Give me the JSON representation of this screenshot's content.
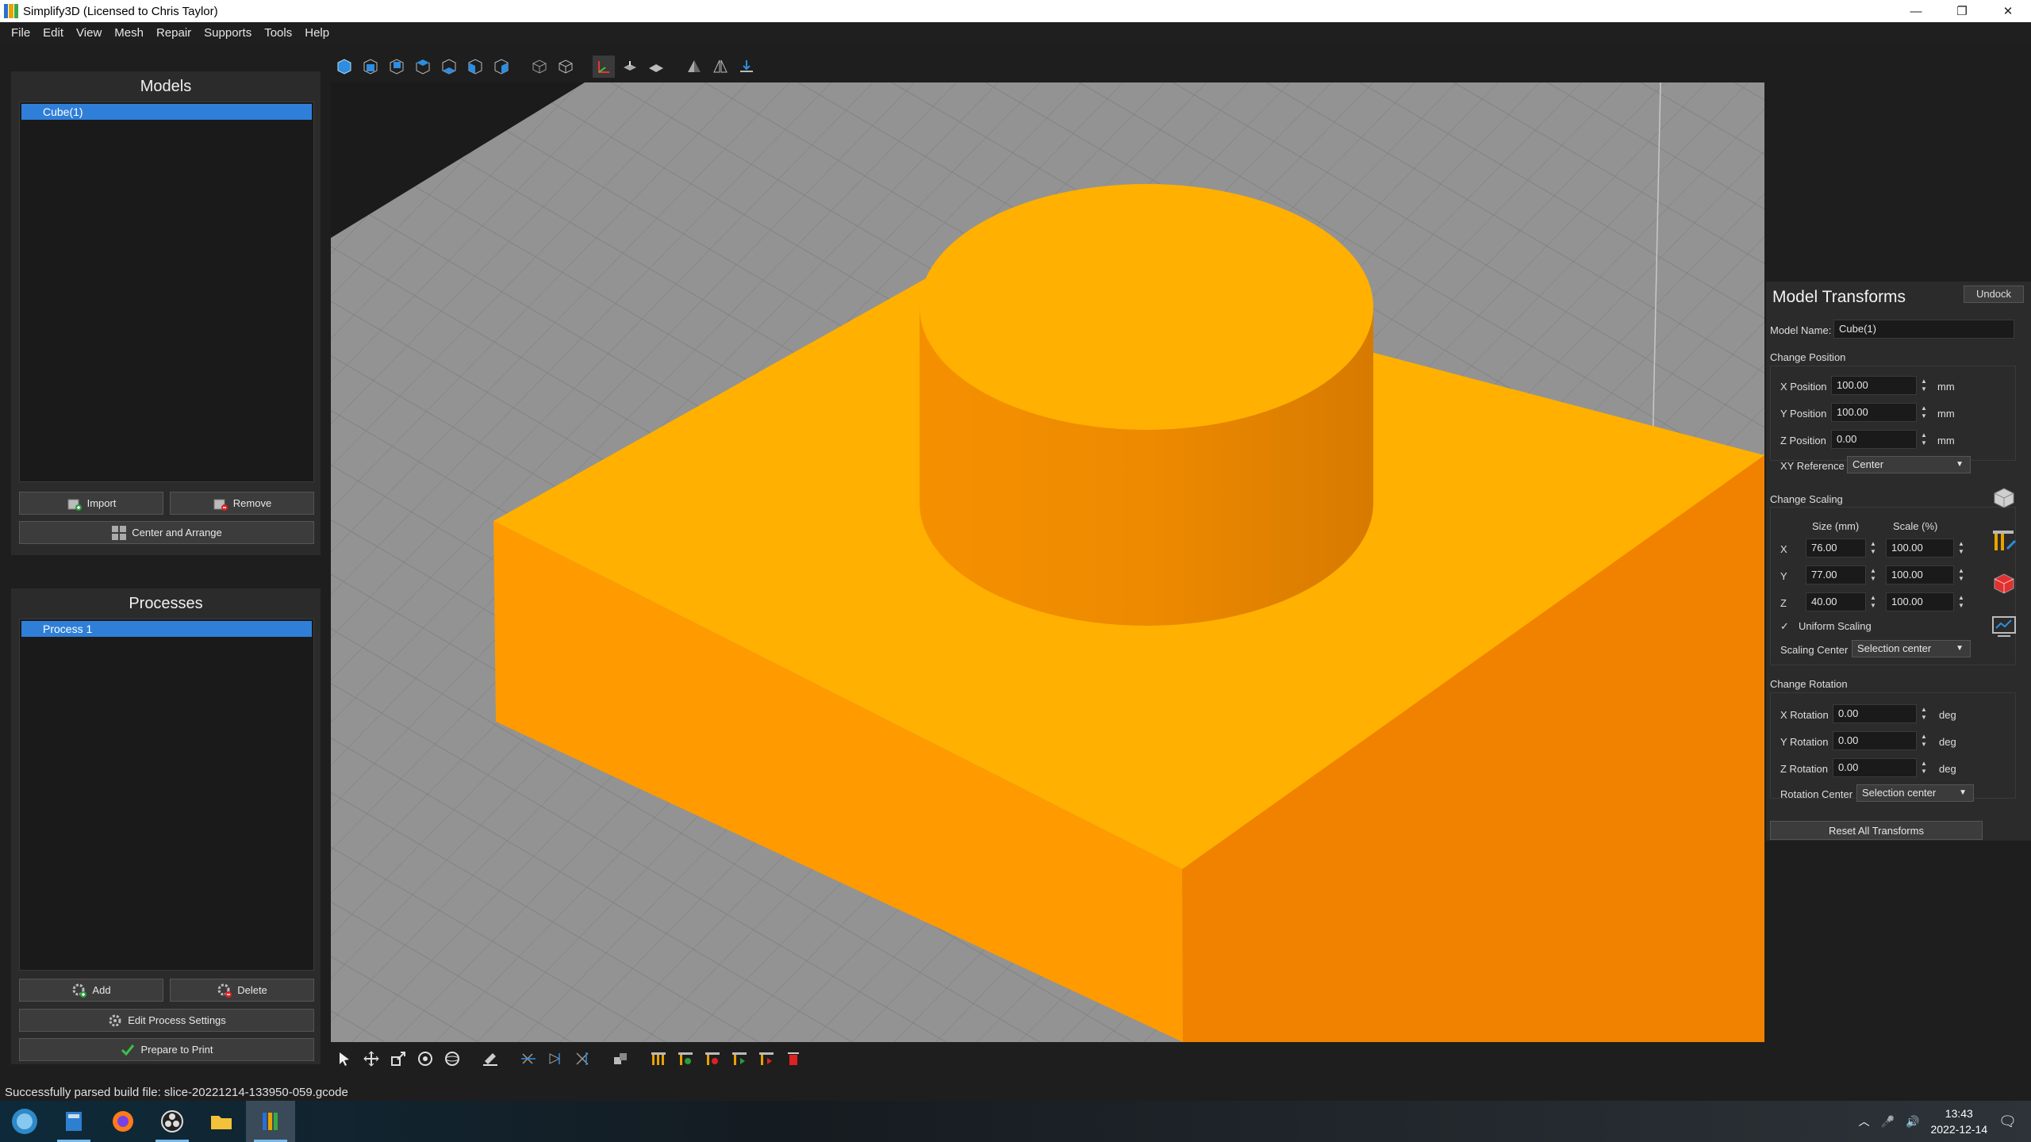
{
  "window": {
    "title": "Simplify3D (Licensed to Chris Taylor)",
    "controls": {
      "minimize": "—",
      "maximize": "❐",
      "close": "✕"
    }
  },
  "menu": [
    "File",
    "Edit",
    "View",
    "Mesh",
    "Repair",
    "Supports",
    "Tools",
    "Help"
  ],
  "models": {
    "title": "Models",
    "items": [
      "Cube(1)"
    ],
    "import": "Import",
    "remove": "Remove",
    "center_arrange": "Center and Arrange"
  },
  "processes": {
    "title": "Processes",
    "items": [
      "Process 1"
    ],
    "add": "Add",
    "delete": "Delete",
    "edit_settings": "Edit Process Settings",
    "prepare": "Prepare to Print"
  },
  "transforms": {
    "title": "Model Transforms",
    "undock": "Undock",
    "model_name_label": "Model Name:",
    "model_name": "Cube(1)",
    "change_position": "Change Position",
    "x_pos_label": "X Position",
    "x_pos": "100.00",
    "y_pos_label": "Y Position",
    "y_pos": "100.00",
    "z_pos_label": "Z Position",
    "z_pos": "0.00",
    "unit_mm": "mm",
    "xy_ref_label": "XY Reference",
    "xy_ref": "Center",
    "change_scaling": "Change Scaling",
    "size_header": "Size (mm)",
    "scale_header": "Scale (%)",
    "axes": [
      "X",
      "Y",
      "Z"
    ],
    "sizes": [
      "76.00",
      "77.00",
      "40.00"
    ],
    "scales": [
      "100.00",
      "100.00",
      "100.00"
    ],
    "uniform_scaling": "Uniform Scaling",
    "uniform_checked": true,
    "scaling_center_label": "Scaling Center",
    "scaling_center": "Selection center",
    "change_rotation": "Change Rotation",
    "x_rot_label": "X Rotation",
    "x_rot": "0.00",
    "y_rot_label": "Y Rotation",
    "y_rot": "0.00",
    "z_rot_label": "Z Rotation",
    "z_rot": "0.00",
    "unit_deg": "deg",
    "rotation_center_label": "Rotation Center",
    "rotation_center": "Selection center",
    "reset": "Reset All Transforms"
  },
  "status": "Successfully parsed build file: slice-20221214-133950-059.gcode",
  "taskbar": {
    "time": "13:43",
    "date": "2022-12-14"
  },
  "colors": {
    "selection": "#2f7fd9",
    "model_top": "#ffb000",
    "model_left": "#ff9a00",
    "model_right": "#f08200",
    "bed": "#8f8f8f"
  }
}
